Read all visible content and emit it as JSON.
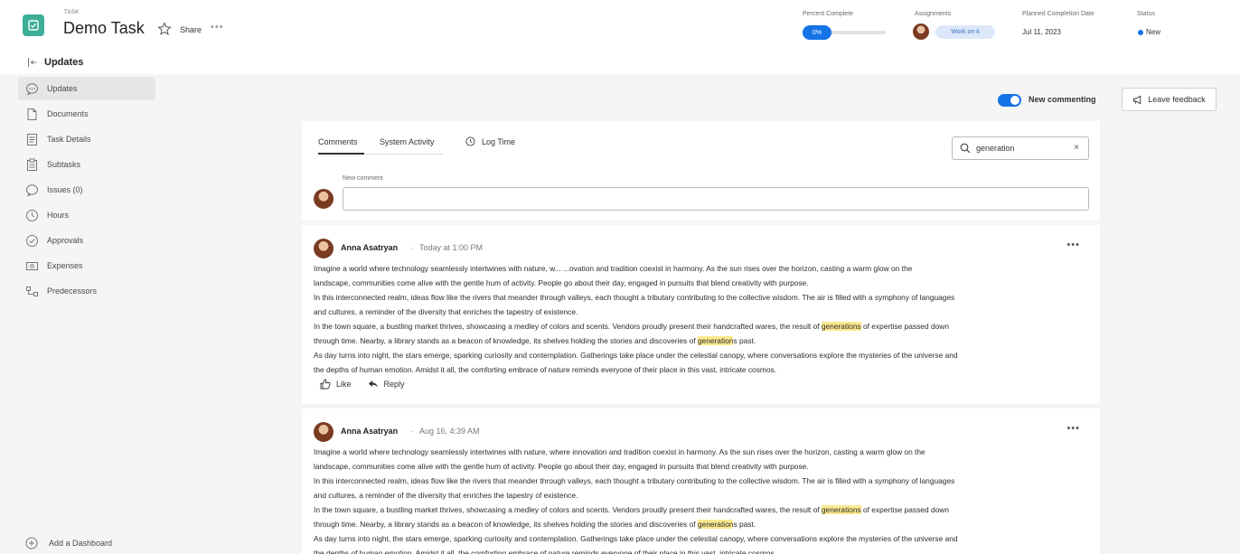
{
  "header": {
    "kicker": "TASK",
    "title": "Demo Task",
    "share_label": "Share",
    "more": "•••",
    "percent_complete_label": "Percent Complete",
    "percent_value": "0%",
    "percent_fraction": 0,
    "assignments_label": "Assignments",
    "work_on_it": "Work on it",
    "planned_label": "Planned Completion Date",
    "planned_value": "Jul 11, 2023",
    "status_label": "Status",
    "status_value": "New",
    "accent": "#1473e6",
    "task_icon_color": "#3cae97"
  },
  "updates_heading": "Updates",
  "sidebar": {
    "items": [
      {
        "label": "Updates",
        "icon": "chat-bubble-icon",
        "active": true
      },
      {
        "label": "Documents",
        "icon": "document-icon"
      },
      {
        "label": "Task Details",
        "icon": "details-icon"
      },
      {
        "label": "Subtasks",
        "icon": "subtasks-icon"
      },
      {
        "label": "Issues (0)",
        "icon": "issues-icon"
      },
      {
        "label": "Hours",
        "icon": "clock-icon"
      },
      {
        "label": "Approvals",
        "icon": "check-circle-icon"
      },
      {
        "label": "Expenses",
        "icon": "expenses-icon"
      },
      {
        "label": "Predecessors",
        "icon": "predecessors-icon"
      }
    ],
    "add_dashboard": "Add a Dashboard"
  },
  "toolbar": {
    "new_commenting": "New commenting",
    "leave_feedback": "Leave feedback"
  },
  "tabs": {
    "comments": "Comments",
    "system_activity": "System Activity",
    "log_time": "Log Time"
  },
  "search": {
    "value": "generation",
    "clear": "×"
  },
  "new_comment": {
    "label": "New comment",
    "placeholder": ""
  },
  "comments": [
    {
      "author": "Anna Asatryan",
      "sep": "·",
      "time": "Today at 1:00 PM",
      "more": "•••",
      "like": "Like",
      "reply": "Reply",
      "lines": [
        "Imagine a world where technology seamlessly intertwines with nature, w... ...ovation and tradition coexist in harmony. As the sun rises over the horizon, casting a warm glow on the",
        "landscape, communities come alive with the gentle hum of activity. People go about their day, engaged in pursuits that blend creativity with purpose.",
        "In this interconnected realm, ideas flow like the rivers that meander through valleys, each thought a tributary contributing to the collective wisdom. The air is filled with a symphony of languages",
        "and cultures, a reminder of the diversity that enriches the tapestry of existence.",
        "In the town square, a bustling market thrives, showcasing a medley of colors and scents. Vendors proudly present their handcrafted wares, the result of ",
        "generations",
        " of expertise passed down",
        "through time. Nearby, a library stands as a beacon of knowledge, its shelves holding the stories and discoveries of ",
        "generation",
        "s past.",
        "As day turns into night, the stars emerge, sparking curiosity and contemplation. Gatherings take place under the celestial canopy, where conversations explore the mysteries of the universe and",
        "the depths of human emotion. Amidst it all, the comforting embrace of nature reminds everyone of their place in this vast, intricate cosmos."
      ]
    },
    {
      "author": "Anna Asatryan",
      "sep": "·",
      "time": "Aug 16, 4:39 AM",
      "more": "•••",
      "lines": [
        "Imagine a world where technology seamlessly intertwines with nature, where innovation and tradition coexist in harmony. As the sun rises over the horizon, casting a warm glow on the",
        "landscape, communities come alive with the gentle hum of activity. People go about their day, engaged in pursuits that blend creativity with purpose.",
        "In this interconnected realm, ideas flow like the rivers that meander through valleys, each thought a tributary contributing to the collective wisdom. The air is filled with a symphony of languages",
        "and cultures, a reminder of the diversity that enriches the tapestry of existence.",
        "In the town square, a bustling market thrives, showcasing a medley of colors and scents. Vendors proudly present their handcrafted wares, the result of ",
        "generations",
        " of expertise passed down",
        "through time. Nearby, a library stands as a beacon of knowledge, its shelves holding the stories and discoveries of ",
        "generation",
        "s past.",
        "As day turns into night, the stars emerge, sparking curiosity and contemplation. Gatherings take place under the celestial canopy, where conversations explore the mysteries of the universe and",
        "the depths of human emotion. Amidst it all, the comforting embrace of nature reminds everyone of their place in this vast, intricate cosmos."
      ]
    }
  ]
}
